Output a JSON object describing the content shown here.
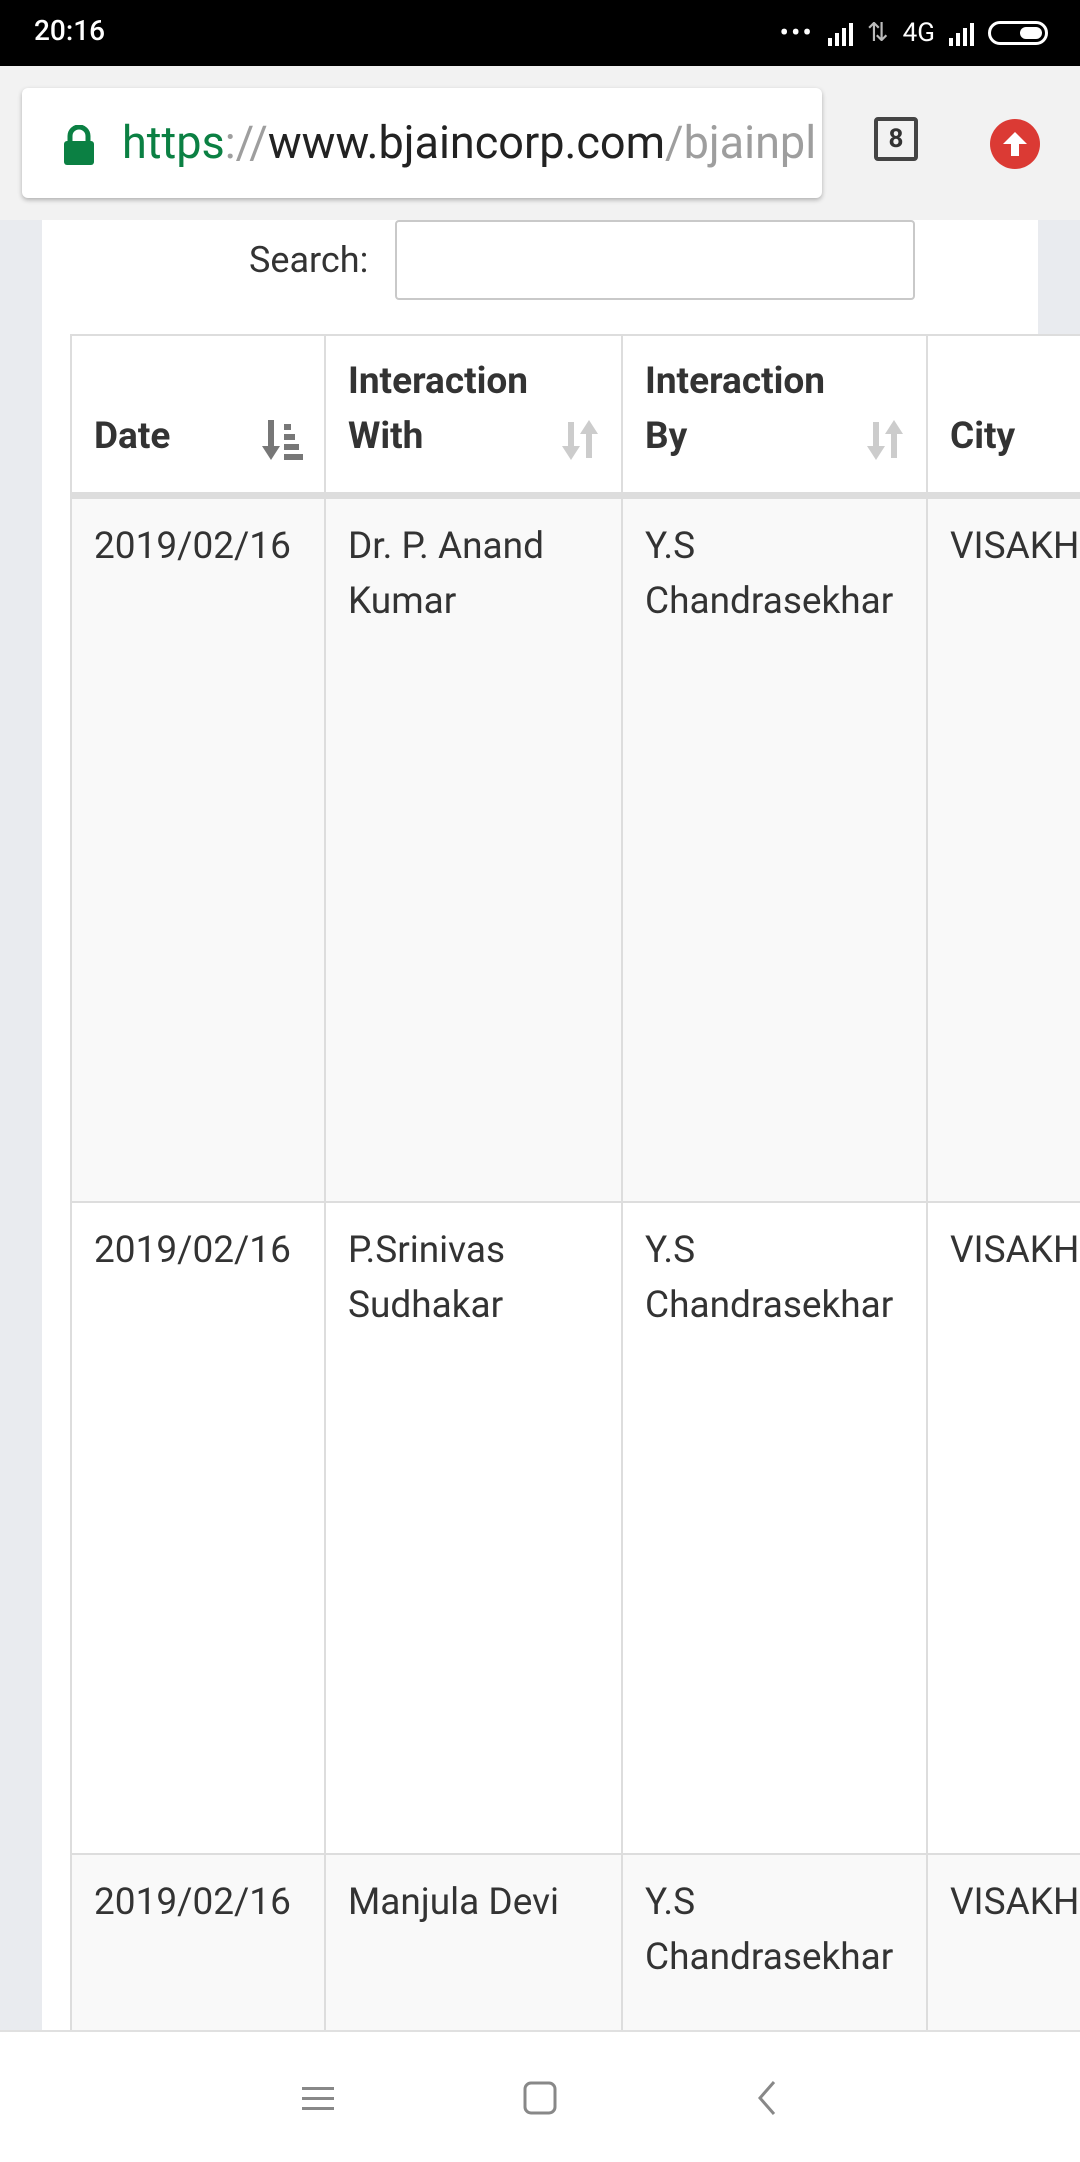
{
  "status_bar": {
    "time": "20:16",
    "network": "4G"
  },
  "browser": {
    "url_scheme": "https",
    "url_separator": "://",
    "url_host": "www.bjaincorp.com",
    "url_path": "/bjainpl",
    "tab_count": "8"
  },
  "search": {
    "label": "Search:",
    "value": "",
    "placeholder": ""
  },
  "table": {
    "headers": [
      {
        "line1": "",
        "line2": "Date",
        "sort": "sorted-asc"
      },
      {
        "line1": "Interaction",
        "line2": "With",
        "sort": "sortable"
      },
      {
        "line1": "Interaction",
        "line2": "By",
        "sort": "sortable"
      },
      {
        "line1": "",
        "line2": "City",
        "sort": "none"
      }
    ],
    "rows": [
      {
        "date": "2019/02/16",
        "with_1": "Dr. P. Anand",
        "with_2": "Kumar",
        "by_1": "Y.S",
        "by_2": "Chandrasekhar",
        "city": "VISAKH"
      },
      {
        "date": "2019/02/16",
        "with_1": "P.Srinivas",
        "with_2": "Sudhakar",
        "by_1": "Y.S",
        "by_2": "Chandrasekhar",
        "city": "VISAKH"
      },
      {
        "date": "2019/02/16",
        "with_1": "Manjula Devi",
        "with_2": "",
        "by_1": "Y.S",
        "by_2": "Chandrasekhar",
        "city": "VISAKH"
      }
    ]
  },
  "colors": {
    "secure_green": "#0b8043",
    "update_red": "#db3a34",
    "row_stripe": "#f9f9f9"
  }
}
